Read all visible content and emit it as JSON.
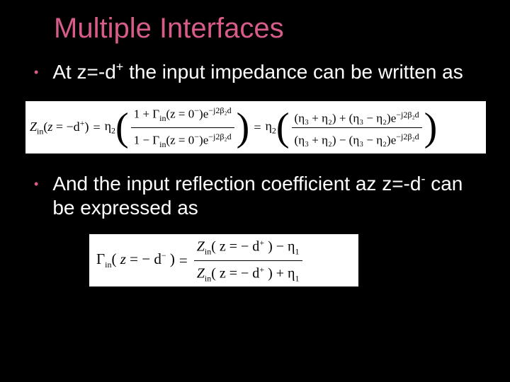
{
  "slide": {
    "title": "Multiple Interfaces",
    "bullets": [
      {
        "lead": "At z=-d",
        "sup": "+",
        "tail": " the input impedance can be written as"
      },
      {
        "lead": "And the input reflection coefficient az z=-d",
        "sup": "-",
        "tail": " can be expressed as"
      }
    ],
    "formulas": {
      "f1": {
        "lhs_prefix": "Z",
        "lhs_sub": "in",
        "lhs_arg_open": "(",
        "lhs_arg_z": "z",
        "lhs_arg_eq": " = ",
        "lhs_arg_val": "−d",
        "lhs_arg_sup": "+",
        "lhs_arg_close": ")",
        "equals": " = ",
        "eta2_label": "η",
        "eta2_sub": "2",
        "mid_equals": " = ",
        "frac1": {
          "num_a": "1 + ",
          "num_gam": "Γ",
          "num_sub": "in",
          "num_args": "(z = 0",
          "num_argsup": "−",
          "num_close": ")e",
          "num_exp": "−j2β₂d",
          "den_a": "1 − ",
          "den_gam": "Γ",
          "den_sub": "in",
          "den_args": "(z = 0",
          "den_argsup": "−",
          "den_close": ")e",
          "den_exp": "−j2β₂d"
        },
        "frac2": {
          "num": "(η₃ + η₂) + (η₃ − η₂)e",
          "num_exp": "−j2β₂d",
          "den": "(η₃ + η₂) − (η₃ − η₂)e",
          "den_exp": "−j2β₂d"
        }
      },
      "f2": {
        "lhs_gam": "Γ",
        "lhs_sub": "in",
        "lhs_arg_open": "( ",
        "lhs_arg_z": "z",
        "lhs_arg_eq": " = ",
        "lhs_arg_val": "− d",
        "lhs_arg_sup": "−",
        "lhs_arg_close": " )",
        "equals": " = ",
        "frac": {
          "num_z": "Z",
          "num_sub": "in",
          "num_arg": "( z = − d",
          "num_argsup": "+",
          "num_close": " ) − η",
          "num_etasub": "1",
          "den_z": "Z",
          "den_sub": "in",
          "den_arg": "( z = − d",
          "den_argsup": "+",
          "den_close": " ) + η",
          "den_etasub": "1"
        }
      }
    },
    "colors": {
      "background": "#000000",
      "text": "#FFFFFF",
      "accent": "#d85c8a"
    }
  }
}
